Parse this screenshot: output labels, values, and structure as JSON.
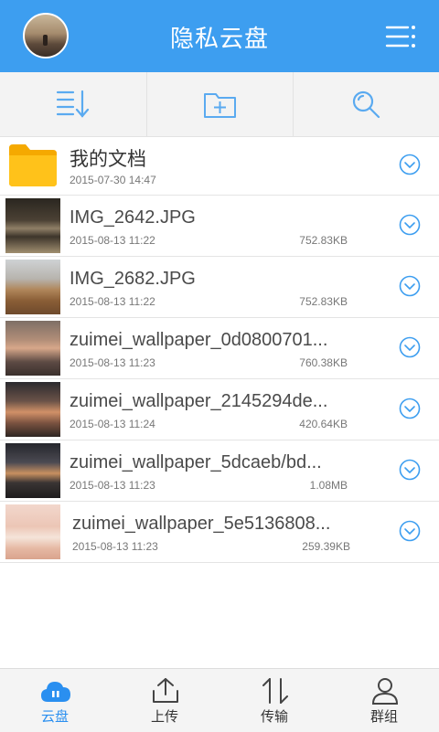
{
  "header": {
    "title": "隐私云盘",
    "avatar_icon": "user-avatar",
    "menu_icon": "list-menu-icon"
  },
  "toolbar": {
    "items": [
      {
        "icon": "sort-icon"
      },
      {
        "icon": "new-folder-icon"
      },
      {
        "icon": "search-icon"
      }
    ]
  },
  "files": [
    {
      "type": "folder",
      "name": "我的文档",
      "date": "2015-07-30 14:47",
      "size": ""
    },
    {
      "type": "image",
      "name": "IMG_2642.JPG",
      "date": "2015-08-13 11:22",
      "size": "752.83KB"
    },
    {
      "type": "image",
      "name": "IMG_2682.JPG",
      "date": "2015-08-13 11:22",
      "size": "752.83KB"
    },
    {
      "type": "image",
      "name": "zuimei_wallpaper_0d0800701...",
      "date": "2015-08-13 11:23",
      "size": "760.38KB"
    },
    {
      "type": "image",
      "name": "zuimei_wallpaper_2145294de...",
      "date": "2015-08-13 11:24",
      "size": "420.64KB"
    },
    {
      "type": "image",
      "name": "zuimei_wallpaper_5dcaeb/bd...",
      "date": "2015-08-13 11:23",
      "size": "1.08MB"
    },
    {
      "type": "image",
      "name": "zuimei_wallpaper_5e5136808...",
      "date": "2015-08-13 11:23",
      "size": "259.39KB"
    }
  ],
  "tabs": [
    {
      "label": "云盘",
      "icon": "cloud-icon",
      "active": true
    },
    {
      "label": "上传",
      "icon": "upload-icon",
      "active": false
    },
    {
      "label": "传输",
      "icon": "transfer-icon",
      "active": false
    },
    {
      "label": "群组",
      "icon": "group-icon",
      "active": false
    }
  ],
  "colors": {
    "accent": "#3d9ef0",
    "folder": "#ffc21a"
  }
}
